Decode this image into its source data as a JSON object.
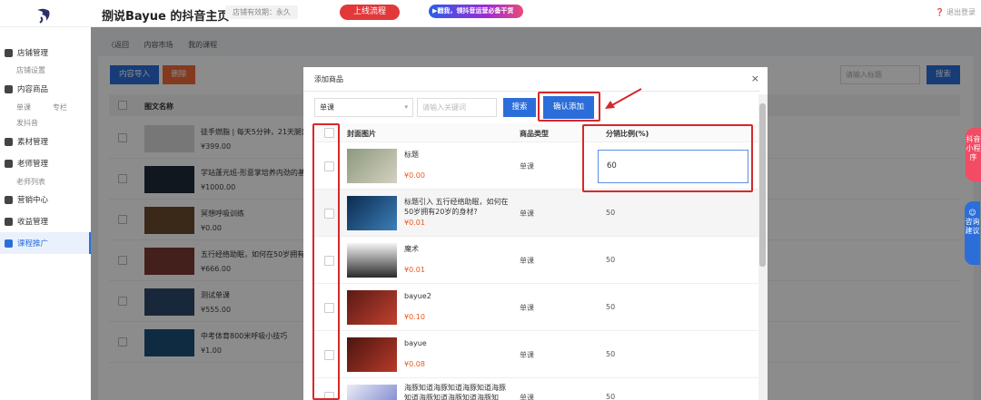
{
  "header": {
    "shop_title": "捌说Bayue 的抖音主页",
    "valid_label": "店铺有效期：永久",
    "online_button": "上线流程",
    "promo_banner": "▶戳我，领抖音运营必备干货",
    "logout": "退出登录"
  },
  "sidebar": {
    "store_mgmt": "店铺管理",
    "store_settings": "店铺设置",
    "content_products": "内容商品",
    "single_course": "单课",
    "column": "专栏",
    "publish_douyin": "发抖音",
    "material_mgmt": "素材管理",
    "teacher_mgmt": "老师管理",
    "teacher_list": "老师列表",
    "marketing_center": "营销中心",
    "revenue_mgmt": "收益管理",
    "course_promo": "课程推广"
  },
  "main": {
    "breadcrumb": [
      "〈返回",
      "内容市场",
      "我的课程"
    ],
    "import_button": "内容导入",
    "delete_button": "删除",
    "title_placeholder": "请输入标题",
    "search_button": "搜索",
    "column_header": "图文名称",
    "rows": [
      {
        "name": "徒手燃脂 | 每天5分钟，21天腿部",
        "price": "¥399.00"
      },
      {
        "name": "学站蓬元班-形意掌培养内劲的基",
        "price": "¥1000.00"
      },
      {
        "name": "冥想呼吸训练",
        "price": "¥0.00"
      },
      {
        "name": "五行经络助眠，如何在50岁拥有",
        "price": "¥666.00"
      },
      {
        "name": "测试单课",
        "price": "¥555.00"
      },
      {
        "name": "中考体育800米呼吸小技巧",
        "price": "¥1.00"
      }
    ]
  },
  "float_tabs": {
    "douyin_mini": "抖音小程序",
    "consult": "咨询建议"
  },
  "modal": {
    "title": "添加商品",
    "close": "×",
    "type_select": "单课",
    "keyword_placeholder": "请输入关键词",
    "search_button": "搜索",
    "confirm_button": "确认添加",
    "col_cover": "封面图片",
    "col_type": "商品类型",
    "col_ratio": "分销比例(%)",
    "rows": [
      {
        "name": "标题",
        "price": "¥0.00",
        "type": "单课",
        "ratio": "60",
        "editing": true
      },
      {
        "name": "标题引入 五行经络助眠，如何在50岁拥有20岁的身材?",
        "price": "¥0.01",
        "type": "单课",
        "ratio": "50"
      },
      {
        "name": "魔术",
        "price": "¥0.01",
        "type": "单课",
        "ratio": "50"
      },
      {
        "name": "bayue2",
        "price": "¥0.10",
        "type": "单课",
        "ratio": "50"
      },
      {
        "name": "bayue",
        "price": "¥0.08",
        "type": "单课",
        "ratio": "50"
      },
      {
        "name": "海豚知道海豚知道海豚知道海豚知道海豚知道海豚知道海豚知",
        "price": "",
        "type": "单课",
        "ratio": "50"
      }
    ]
  },
  "colors": {
    "primary": "#2c6ed9",
    "danger": "#ef6a3a",
    "price": "#e85b21",
    "annotation": "#d6282b"
  }
}
